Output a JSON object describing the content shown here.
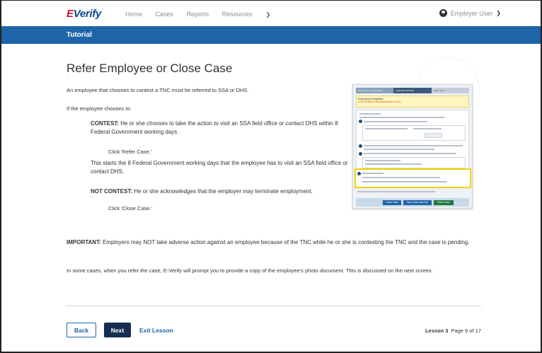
{
  "header": {
    "logo_e": "E",
    "logo_verify": "Verify",
    "nav": [
      "Home",
      "Cases",
      "Reports",
      "Resources"
    ],
    "user_label": "Employer User"
  },
  "banner": {
    "title": "Tutorial"
  },
  "main": {
    "title": "Refer Employee or Close Case",
    "intro": "An employee that chooses to contest a TNC must be referred to SSA or DHS.",
    "if_chooses": "If the employee chooses to:",
    "contest_label": "CONTEST:",
    "contest_text": "He or she chooses to take the action to visit an SSA field office or contact DHS within 8 Federal Government working days.",
    "click_refer": "Click 'Refer Case.'",
    "starts_text": "This starts the 8 Federal Government working days that the employee has to visit an SSA field office or contact DHS.",
    "not_contest_label": "NOT CONTEST:",
    "not_contest_text": "He or she acknowledges that the employer may terminate employment.",
    "click_close": "Click 'Close Case.'",
    "important_label": "IMPORTANT:",
    "important_text": "Employers may NOT take adverse action against an employee because of the TNC while he or she is contesting the TNC and the case is pending.",
    "photo_text": "In some cases, when you refer the case, E-Verify will prompt you to provide a copy of the employee's photo document. This is discussed on the next screen."
  },
  "thumbnail": {
    "steps": [
      "Enter Form I-9 Information",
      "Verification Results",
      "Close Case"
    ],
    "eligibility_label": "Employment Eligibility:",
    "eligibility_value": "SSA Tentative Nonconfirmation (TNC)",
    "buttons": [
      "Close Case",
      "Save Case and Exit",
      "Refer Case"
    ]
  },
  "footer": {
    "back_label": "Back",
    "next_label": "Next",
    "exit_label": "Exit Lesson",
    "lesson_label": "Lesson 3",
    "page_label": "Page 9 of 17"
  },
  "colors": {
    "brand_blue": "#1f64a8",
    "navy": "#152e52",
    "highlight_yellow": "#f2d400",
    "logo_red": "#c8102e"
  }
}
